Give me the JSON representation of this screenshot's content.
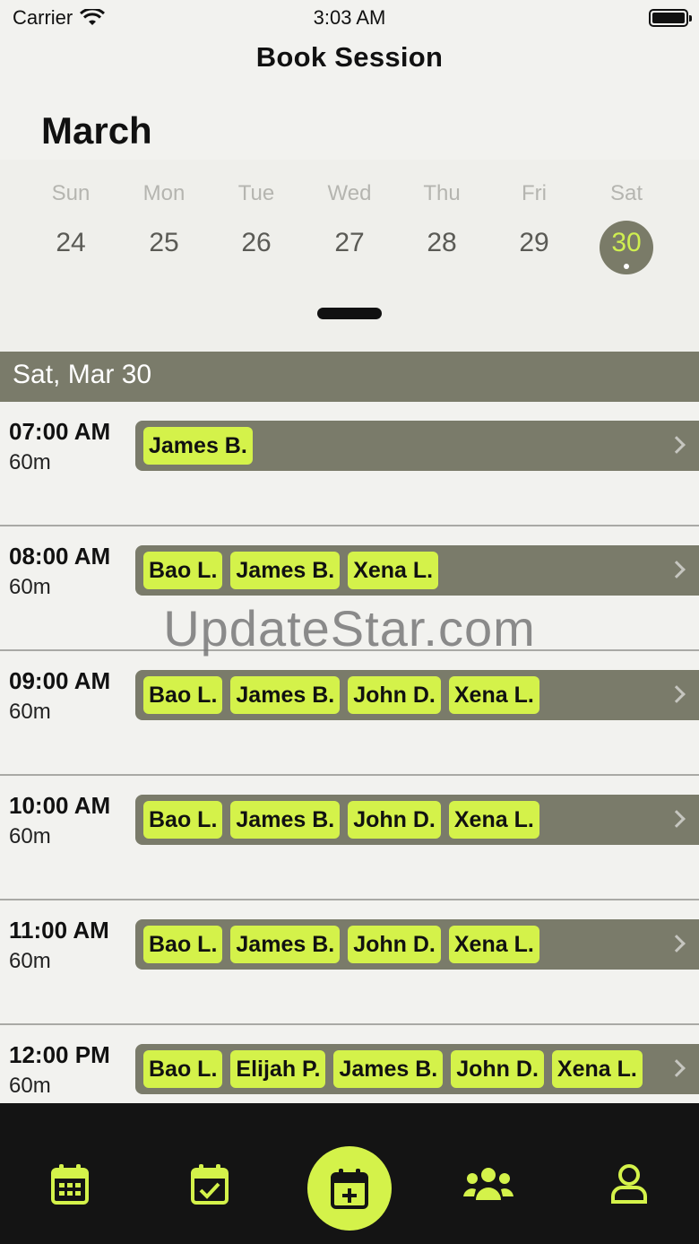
{
  "status_bar": {
    "carrier": "Carrier",
    "time": "3:03 AM"
  },
  "nav": {
    "title": "Book Session"
  },
  "calendar": {
    "month": "March",
    "days": [
      {
        "name": "Sun",
        "num": "24",
        "selected": false
      },
      {
        "name": "Mon",
        "num": "25",
        "selected": false
      },
      {
        "name": "Tue",
        "num": "26",
        "selected": false
      },
      {
        "name": "Wed",
        "num": "27",
        "selected": false
      },
      {
        "name": "Thu",
        "num": "28",
        "selected": false
      },
      {
        "name": "Fri",
        "num": "29",
        "selected": false
      },
      {
        "name": "Sat",
        "num": "30",
        "selected": true
      }
    ]
  },
  "date_header": "Sat, Mar 30",
  "slots": [
    {
      "time": "07:00 AM",
      "duration": "60m",
      "people": [
        "James B."
      ]
    },
    {
      "time": "08:00 AM",
      "duration": "60m",
      "people": [
        "Bao L.",
        "James B.",
        "Xena L."
      ]
    },
    {
      "time": "09:00 AM",
      "duration": "60m",
      "people": [
        "Bao L.",
        "James B.",
        "John D.",
        "Xena L."
      ]
    },
    {
      "time": "10:00 AM",
      "duration": "60m",
      "people": [
        "Bao L.",
        "James B.",
        "John D.",
        "Xena L."
      ]
    },
    {
      "time": "11:00 AM",
      "duration": "60m",
      "people": [
        "Bao L.",
        "James B.",
        "John D.",
        "Xena L."
      ]
    },
    {
      "time": "12:00 PM",
      "duration": "60m",
      "people": [
        "Bao L.",
        "Elijah P.",
        "James B.",
        "John D.",
        "Xena L."
      ]
    }
  ],
  "watermark": "UpdateStar.com",
  "tabbar": {
    "tabs": [
      "calendar-icon",
      "calendar-check-icon",
      "calendar-plus-icon",
      "users-icon",
      "user-icon"
    ],
    "accent": "#d4f24a",
    "background": "#141414"
  },
  "colors": {
    "accent": "#d4f24a",
    "bar": "#7a7b6a",
    "background": "#f2f2ef"
  }
}
